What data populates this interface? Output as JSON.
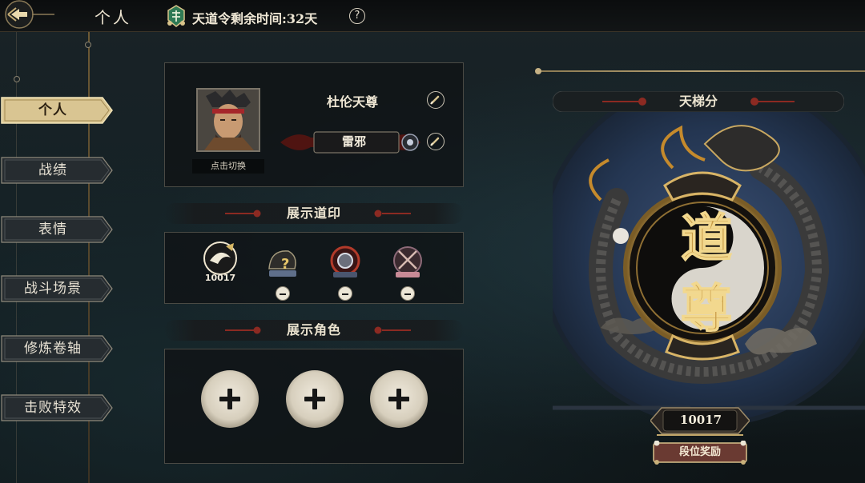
{
  "header": {
    "title": "个人",
    "token_label": "天道令剩余时间:",
    "token_value": "32天",
    "help": "?"
  },
  "sidebar": {
    "items": [
      {
        "label": "个人",
        "active": true
      },
      {
        "label": "战绩",
        "active": false
      },
      {
        "label": "表情",
        "active": false
      },
      {
        "label": "战斗场景",
        "active": false
      },
      {
        "label": "修炼卷轴",
        "active": false
      },
      {
        "label": "击败特效",
        "active": false
      }
    ]
  },
  "profile": {
    "name": "杜伦天尊",
    "avatar_caption": "点击切换",
    "title_badge": "雷邪"
  },
  "seals": {
    "title": "展示道印",
    "items": [
      {
        "icon": "ladder-seal-icon",
        "label": "10017",
        "removable": false
      },
      {
        "icon": "mystery-seal-icon",
        "label": "",
        "removable": true
      },
      {
        "icon": "red-disc-seal-icon",
        "label": "",
        "removable": true
      },
      {
        "icon": "blade-seal-icon",
        "label": "",
        "removable": true
      }
    ]
  },
  "characters": {
    "title": "展示角色",
    "slots": 3
  },
  "ladder": {
    "title": "天梯分",
    "rank_glyphs": [
      "道",
      "尊"
    ],
    "score": "10017",
    "reward_button": "段位奖励"
  },
  "colors": {
    "gold": "#c9a861",
    "panel_bg": "#101416",
    "cream": "#ece4d0",
    "accent_red": "#8c2a22"
  }
}
